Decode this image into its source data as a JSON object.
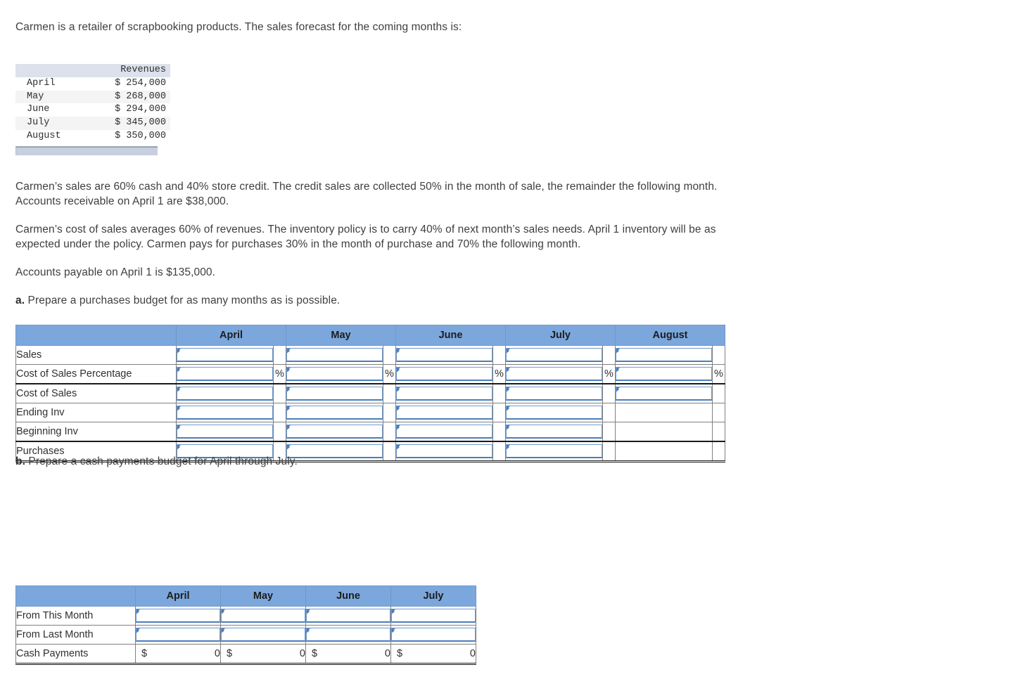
{
  "intro": "Carmen is a retailer of scrapbooking products. The sales forecast for the coming months is:",
  "revenues_table": {
    "header_blank": "",
    "header_value": "Revenues",
    "rows": [
      {
        "month": "April",
        "amount": "$ 254,000"
      },
      {
        "month": "May",
        "amount": "$ 268,000"
      },
      {
        "month": "June",
        "amount": "$ 294,000"
      },
      {
        "month": "July",
        "amount": "$ 345,000"
      },
      {
        "month": "August",
        "amount": "$ 350,000"
      }
    ]
  },
  "paragraphs": {
    "p1": "Carmen’s sales are 60% cash and 40% store credit. The credit sales are collected 50% in the month of sale, the remainder the following month. Accounts receivable on April 1 are $38,000.",
    "p2": "Carmen’s cost of sales averages 60% of revenues. The inventory policy is to carry 40% of next month’s sales needs. April 1 inventory will be as expected under the policy. Carmen pays for purchases 30% in the month of purchase and 70% the following month.",
    "p3": "Accounts payable on April 1 is $135,000.",
    "q_a_marker": "a.",
    "q_a_text": " Prepare a purchases budget for as many months as is possible.",
    "q_b_marker": "b.",
    "q_b_text": " Prepare a cash payments budget for April through July."
  },
  "purchases_budget": {
    "row_header_label": "",
    "columns": [
      "April",
      "May",
      "June",
      "July",
      "August"
    ],
    "percent_symbol": "%",
    "rows": [
      {
        "label": "Sales",
        "inputs": [
          true,
          true,
          true,
          true,
          true
        ],
        "percent": false
      },
      {
        "label": "Cost of Sales Percentage",
        "inputs": [
          true,
          true,
          true,
          true,
          true
        ],
        "percent": true
      },
      {
        "label": "Cost of Sales",
        "inputs": [
          true,
          true,
          true,
          true,
          true
        ],
        "percent": false
      },
      {
        "label": "Ending Inv",
        "inputs": [
          true,
          true,
          true,
          true,
          false
        ],
        "percent": false
      },
      {
        "label": "Beginning Inv",
        "inputs": [
          true,
          true,
          true,
          true,
          false
        ],
        "percent": false
      },
      {
        "label": "Purchases",
        "inputs": [
          true,
          true,
          true,
          true,
          false
        ],
        "percent": false
      }
    ]
  },
  "cash_payments_budget": {
    "row_header_label": "",
    "columns": [
      "April",
      "May",
      "June",
      "July"
    ],
    "rows": [
      {
        "label": "From This Month",
        "type": "input"
      },
      {
        "label": "From Last Month",
        "type": "input"
      },
      {
        "label": "Cash Payments",
        "type": "total",
        "currency": "$",
        "values": [
          "0",
          "0",
          "0",
          "0"
        ]
      }
    ]
  },
  "colors": {
    "header_blue": "#7ba7dd",
    "input_border": "#4a7ebb",
    "rev_header_gray": "#dce1eb",
    "text": "#3f3f3f"
  }
}
